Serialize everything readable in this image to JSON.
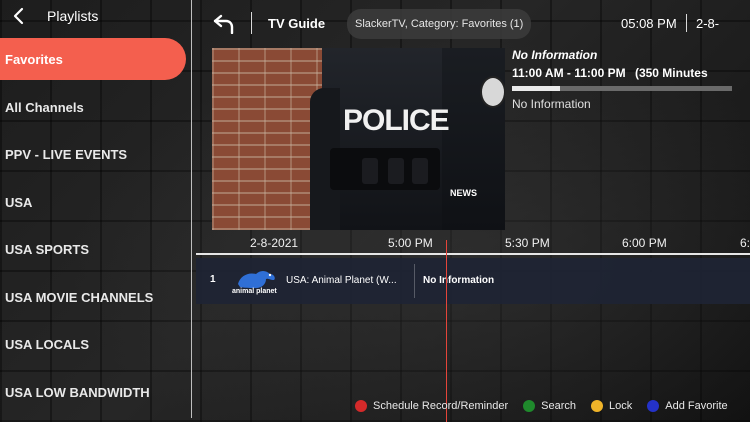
{
  "sidebar": {
    "title": "Playlists",
    "back_icon": "chevron-left-icon",
    "items": [
      {
        "label": "Favorites",
        "active": true
      },
      {
        "label": "All Channels",
        "active": false
      },
      {
        "label": "PPV - LIVE EVENTS",
        "active": false
      },
      {
        "label": "USA",
        "active": false
      },
      {
        "label": "USA SPORTS",
        "active": false
      },
      {
        "label": "USA MOVIE CHANNELS",
        "active": false
      },
      {
        "label": "USA LOCALS",
        "active": false
      },
      {
        "label": "USA LOW BANDWIDTH",
        "active": false
      }
    ],
    "active_color": "#f45f4e"
  },
  "header": {
    "back_icon": "undo-arrow-icon",
    "title": "TV Guide",
    "filter_chip": "SlackerTV, Category: Favorites (1)",
    "time": "05:08 PM",
    "date": "2-8-"
  },
  "preview": {
    "description": "video-thumbnail",
    "overlay_text": "POLICE",
    "network_logo": "NEWS"
  },
  "program_info": {
    "title": "No Information",
    "time_range": "11:00 AM - 11:00 PM",
    "duration": "(350 Minutes",
    "progress": 0.22,
    "description": "No Information"
  },
  "timeline": {
    "date": "2-8-2021",
    "slots": [
      "5:00 PM",
      "5:30 PM",
      "6:00 PM",
      "6:"
    ]
  },
  "channels": [
    {
      "number": "1",
      "logo_icon": "animal-planet-logo-icon",
      "logo_text": "animal planet",
      "name": "USA: Animal Planet (W...",
      "program": "No Information"
    }
  ],
  "legend": [
    {
      "label": "Schedule Record/Reminder",
      "color": "#d42a2a",
      "icon": "red-button-icon"
    },
    {
      "label": "Search",
      "color": "#1f8a2c",
      "icon": "green-button-icon"
    },
    {
      "label": "Lock",
      "color": "#f0b429",
      "icon": "yellow-button-icon"
    },
    {
      "label": "Add Favorite",
      "color": "#2432c9",
      "icon": "blue-button-icon"
    }
  ],
  "colors": {
    "now_indicator": "#e5453a",
    "channel_row_bg": "#1e2434"
  }
}
